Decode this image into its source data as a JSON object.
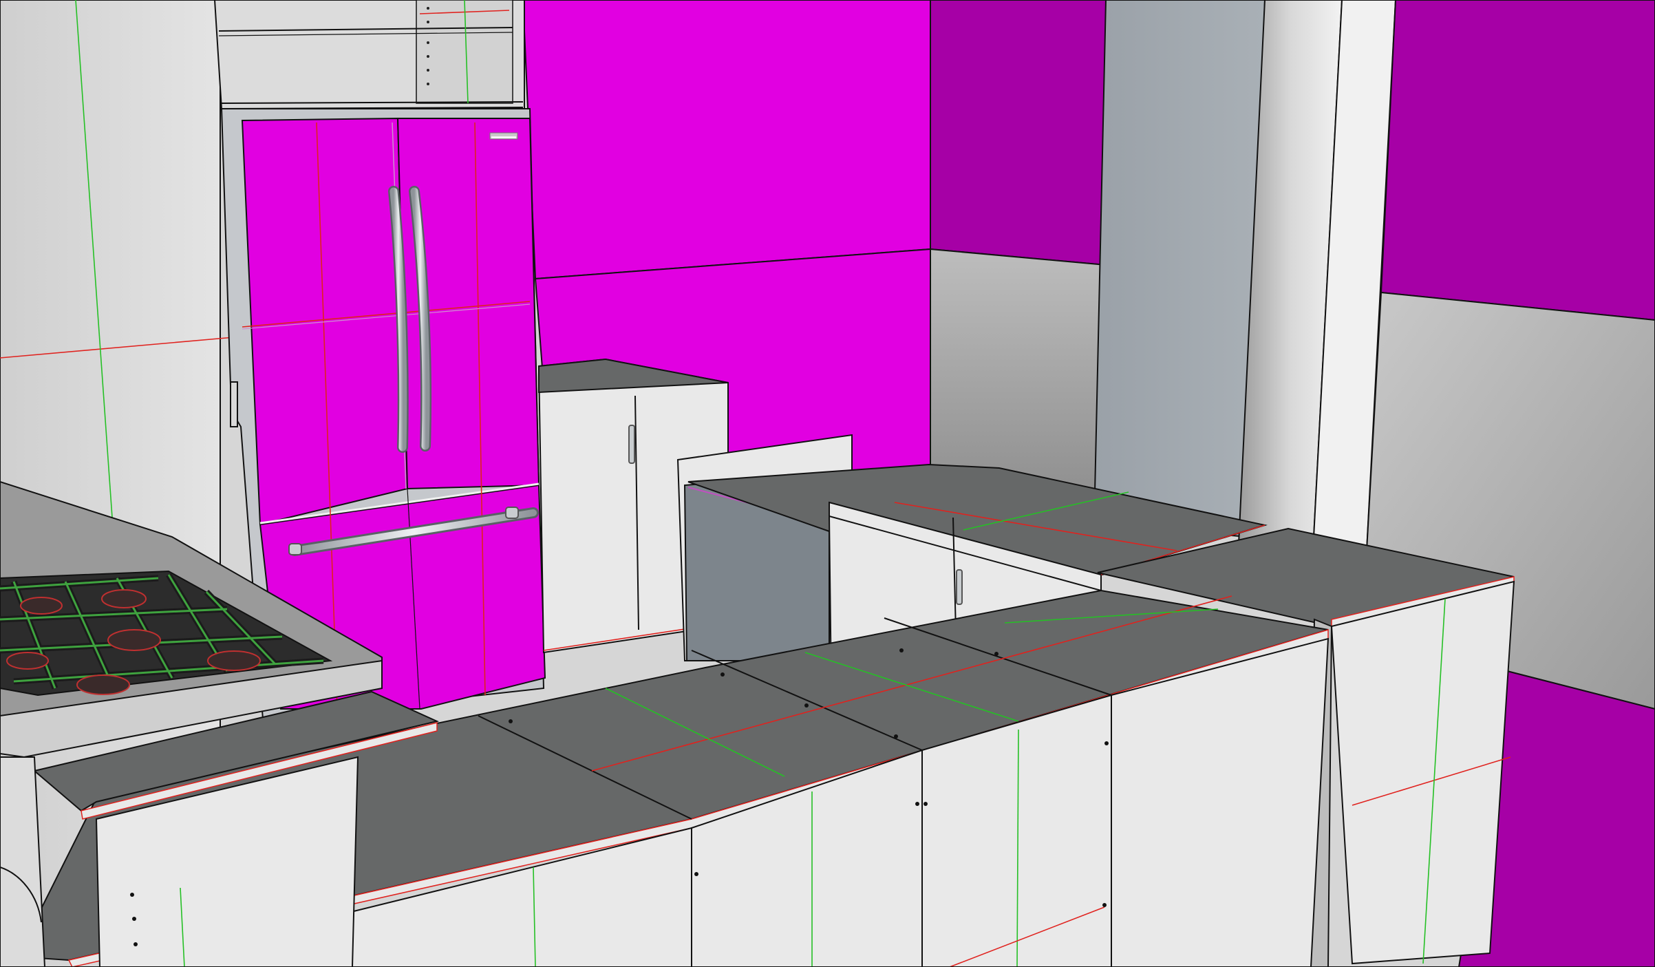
{
  "scene": {
    "description_type": "3d-model-viewport",
    "colors": {
      "magenta": "#e100e1",
      "magenta_dark": "#a600a6",
      "wall_light": "#dcdcdc",
      "wall_grey": "#a6a6a6",
      "steel_column": "#9aa1a8",
      "countertop": "#666868",
      "cabinet": "#e9e9e9",
      "axis_red": "#e0221e",
      "axis_green": "#25c025"
    },
    "fridge": {
      "brand_badge": "▬▬▬▬"
    }
  }
}
